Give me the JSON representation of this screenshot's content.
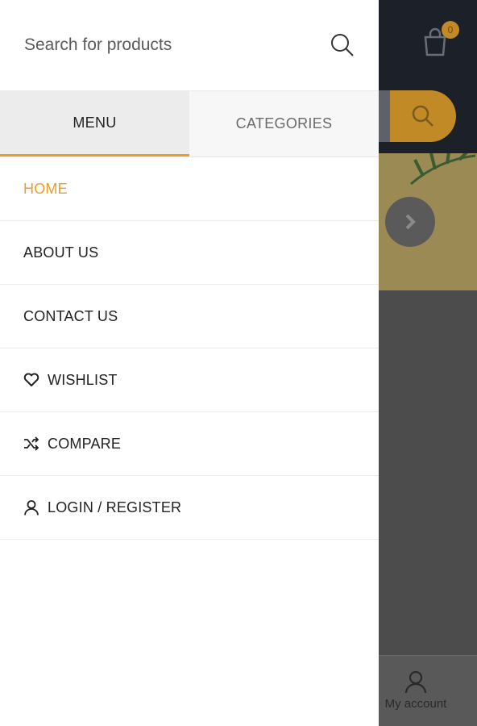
{
  "drawer": {
    "search": {
      "placeholder": "Search for products"
    },
    "tabs": [
      {
        "label": "MENU",
        "active": true
      },
      {
        "label": "CATEGORIES",
        "active": false
      }
    ],
    "items": [
      {
        "label": "HOME",
        "active": true,
        "icon": ""
      },
      {
        "label": "ABOUT US",
        "active": false,
        "icon": ""
      },
      {
        "label": "CONTACT US",
        "active": false,
        "icon": ""
      },
      {
        "label": "WISHLIST",
        "active": false,
        "icon": "heart-icon"
      },
      {
        "label": "COMPARE",
        "active": false,
        "icon": "shuffle-icon"
      },
      {
        "label": "LOGIN / REGISTER",
        "active": false,
        "icon": "user-icon"
      }
    ]
  },
  "background": {
    "cart_count": "0",
    "footer_account_label": "My account"
  },
  "colors": {
    "accent": "#e79e2b",
    "header": "#1b2029",
    "overlay": "#4c4c4c"
  }
}
